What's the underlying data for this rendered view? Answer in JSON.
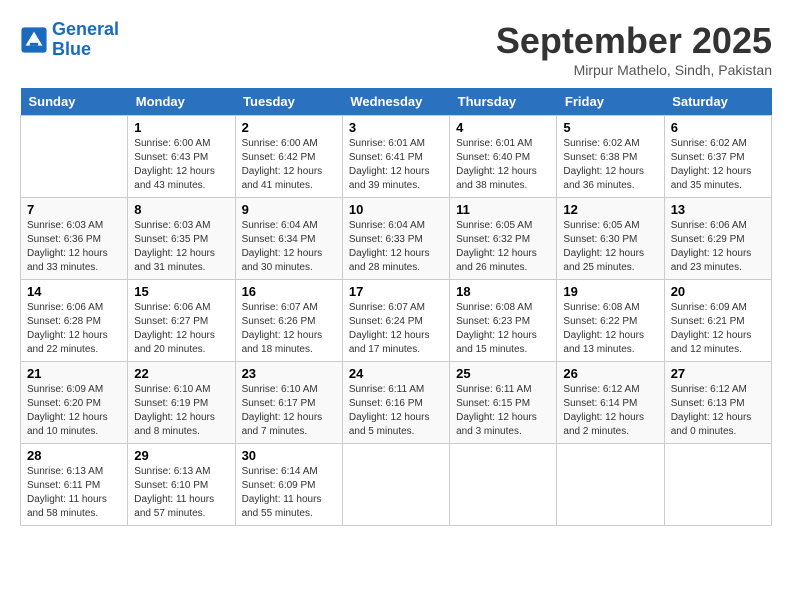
{
  "logo": {
    "line1": "General",
    "line2": "Blue"
  },
  "title": "September 2025",
  "location": "Mirpur Mathelo, Sindh, Pakistan",
  "header_days": [
    "Sunday",
    "Monday",
    "Tuesday",
    "Wednesday",
    "Thursday",
    "Friday",
    "Saturday"
  ],
  "weeks": [
    [
      {
        "day": "",
        "sunrise": "",
        "sunset": "",
        "daylight": ""
      },
      {
        "day": "1",
        "sunrise": "Sunrise: 6:00 AM",
        "sunset": "Sunset: 6:43 PM",
        "daylight": "Daylight: 12 hours and 43 minutes."
      },
      {
        "day": "2",
        "sunrise": "Sunrise: 6:00 AM",
        "sunset": "Sunset: 6:42 PM",
        "daylight": "Daylight: 12 hours and 41 minutes."
      },
      {
        "day": "3",
        "sunrise": "Sunrise: 6:01 AM",
        "sunset": "Sunset: 6:41 PM",
        "daylight": "Daylight: 12 hours and 39 minutes."
      },
      {
        "day": "4",
        "sunrise": "Sunrise: 6:01 AM",
        "sunset": "Sunset: 6:40 PM",
        "daylight": "Daylight: 12 hours and 38 minutes."
      },
      {
        "day": "5",
        "sunrise": "Sunrise: 6:02 AM",
        "sunset": "Sunset: 6:38 PM",
        "daylight": "Daylight: 12 hours and 36 minutes."
      },
      {
        "day": "6",
        "sunrise": "Sunrise: 6:02 AM",
        "sunset": "Sunset: 6:37 PM",
        "daylight": "Daylight: 12 hours and 35 minutes."
      }
    ],
    [
      {
        "day": "7",
        "sunrise": "Sunrise: 6:03 AM",
        "sunset": "Sunset: 6:36 PM",
        "daylight": "Daylight: 12 hours and 33 minutes."
      },
      {
        "day": "8",
        "sunrise": "Sunrise: 6:03 AM",
        "sunset": "Sunset: 6:35 PM",
        "daylight": "Daylight: 12 hours and 31 minutes."
      },
      {
        "day": "9",
        "sunrise": "Sunrise: 6:04 AM",
        "sunset": "Sunset: 6:34 PM",
        "daylight": "Daylight: 12 hours and 30 minutes."
      },
      {
        "day": "10",
        "sunrise": "Sunrise: 6:04 AM",
        "sunset": "Sunset: 6:33 PM",
        "daylight": "Daylight: 12 hours and 28 minutes."
      },
      {
        "day": "11",
        "sunrise": "Sunrise: 6:05 AM",
        "sunset": "Sunset: 6:32 PM",
        "daylight": "Daylight: 12 hours and 26 minutes."
      },
      {
        "day": "12",
        "sunrise": "Sunrise: 6:05 AM",
        "sunset": "Sunset: 6:30 PM",
        "daylight": "Daylight: 12 hours and 25 minutes."
      },
      {
        "day": "13",
        "sunrise": "Sunrise: 6:06 AM",
        "sunset": "Sunset: 6:29 PM",
        "daylight": "Daylight: 12 hours and 23 minutes."
      }
    ],
    [
      {
        "day": "14",
        "sunrise": "Sunrise: 6:06 AM",
        "sunset": "Sunset: 6:28 PM",
        "daylight": "Daylight: 12 hours and 22 minutes."
      },
      {
        "day": "15",
        "sunrise": "Sunrise: 6:06 AM",
        "sunset": "Sunset: 6:27 PM",
        "daylight": "Daylight: 12 hours and 20 minutes."
      },
      {
        "day": "16",
        "sunrise": "Sunrise: 6:07 AM",
        "sunset": "Sunset: 6:26 PM",
        "daylight": "Daylight: 12 hours and 18 minutes."
      },
      {
        "day": "17",
        "sunrise": "Sunrise: 6:07 AM",
        "sunset": "Sunset: 6:24 PM",
        "daylight": "Daylight: 12 hours and 17 minutes."
      },
      {
        "day": "18",
        "sunrise": "Sunrise: 6:08 AM",
        "sunset": "Sunset: 6:23 PM",
        "daylight": "Daylight: 12 hours and 15 minutes."
      },
      {
        "day": "19",
        "sunrise": "Sunrise: 6:08 AM",
        "sunset": "Sunset: 6:22 PM",
        "daylight": "Daylight: 12 hours and 13 minutes."
      },
      {
        "day": "20",
        "sunrise": "Sunrise: 6:09 AM",
        "sunset": "Sunset: 6:21 PM",
        "daylight": "Daylight: 12 hours and 12 minutes."
      }
    ],
    [
      {
        "day": "21",
        "sunrise": "Sunrise: 6:09 AM",
        "sunset": "Sunset: 6:20 PM",
        "daylight": "Daylight: 12 hours and 10 minutes."
      },
      {
        "day": "22",
        "sunrise": "Sunrise: 6:10 AM",
        "sunset": "Sunset: 6:19 PM",
        "daylight": "Daylight: 12 hours and 8 minutes."
      },
      {
        "day": "23",
        "sunrise": "Sunrise: 6:10 AM",
        "sunset": "Sunset: 6:17 PM",
        "daylight": "Daylight: 12 hours and 7 minutes."
      },
      {
        "day": "24",
        "sunrise": "Sunrise: 6:11 AM",
        "sunset": "Sunset: 6:16 PM",
        "daylight": "Daylight: 12 hours and 5 minutes."
      },
      {
        "day": "25",
        "sunrise": "Sunrise: 6:11 AM",
        "sunset": "Sunset: 6:15 PM",
        "daylight": "Daylight: 12 hours and 3 minutes."
      },
      {
        "day": "26",
        "sunrise": "Sunrise: 6:12 AM",
        "sunset": "Sunset: 6:14 PM",
        "daylight": "Daylight: 12 hours and 2 minutes."
      },
      {
        "day": "27",
        "sunrise": "Sunrise: 6:12 AM",
        "sunset": "Sunset: 6:13 PM",
        "daylight": "Daylight: 12 hours and 0 minutes."
      }
    ],
    [
      {
        "day": "28",
        "sunrise": "Sunrise: 6:13 AM",
        "sunset": "Sunset: 6:11 PM",
        "daylight": "Daylight: 11 hours and 58 minutes."
      },
      {
        "day": "29",
        "sunrise": "Sunrise: 6:13 AM",
        "sunset": "Sunset: 6:10 PM",
        "daylight": "Daylight: 11 hours and 57 minutes."
      },
      {
        "day": "30",
        "sunrise": "Sunrise: 6:14 AM",
        "sunset": "Sunset: 6:09 PM",
        "daylight": "Daylight: 11 hours and 55 minutes."
      },
      {
        "day": "",
        "sunrise": "",
        "sunset": "",
        "daylight": ""
      },
      {
        "day": "",
        "sunrise": "",
        "sunset": "",
        "daylight": ""
      },
      {
        "day": "",
        "sunrise": "",
        "sunset": "",
        "daylight": ""
      },
      {
        "day": "",
        "sunrise": "",
        "sunset": "",
        "daylight": ""
      }
    ]
  ]
}
